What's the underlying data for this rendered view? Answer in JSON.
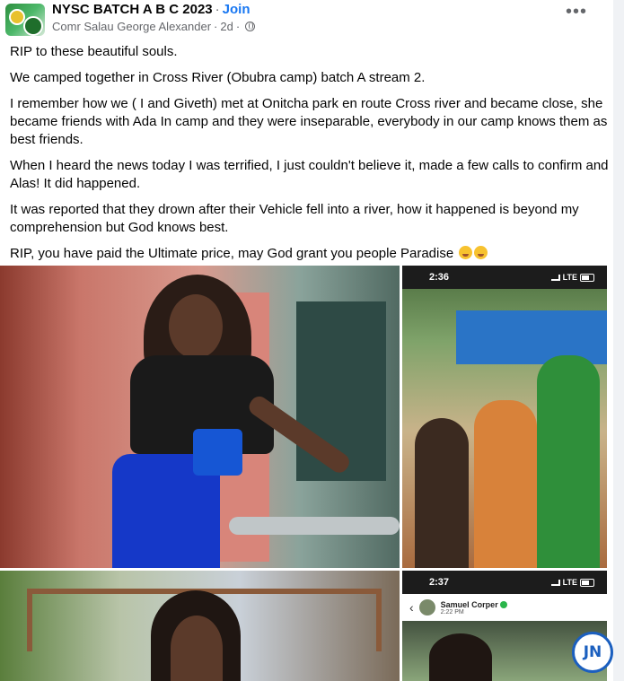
{
  "header": {
    "group_name": "NYSC BATCH A B C 2023",
    "separator": "·",
    "join_label": "Join",
    "author": "Comr Salau George Alexander",
    "time": "2d",
    "more_label": "•••"
  },
  "post": {
    "paragraphs": [
      "RIP to these beautiful souls.",
      "We camped together in Cross River (Obubra camp) batch A stream 2.",
      "I remember how we ( I and Giveth) met at Onitcha park en route Cross river and became close, she became friends with Ada In camp and they were inseparable, everybody in our camp knows them as best friends.",
      "When I heard the news today I was terrified, I just couldn't believe it, made a few calls to confirm and Alas! It did happened.",
      "It was reported that they drown after their Vehicle fell into a river, how it happened is beyond my comprehension but God knows best.",
      "RIP, you have paid the Ultimate price, may God grant you people Paradise"
    ]
  },
  "photos": {
    "photo2_time": "2:36",
    "photo2_network": "LTE",
    "photo4_time": "2:37",
    "photo4_network": "LTE",
    "photo4_chat_name": "Samuel Corper",
    "photo4_chat_time": "2:22 PM"
  },
  "watermark": "JN",
  "colors": {
    "join": "#1877f2",
    "secondary_text": "#65676b",
    "badge": "#1b5fbf"
  },
  "icons": [
    "group-avatar",
    "globe-icon",
    "more-icon",
    "emoji-cry-icon",
    "signal-icon",
    "battery-icon",
    "back-arrow-icon",
    "verified-icon"
  ]
}
